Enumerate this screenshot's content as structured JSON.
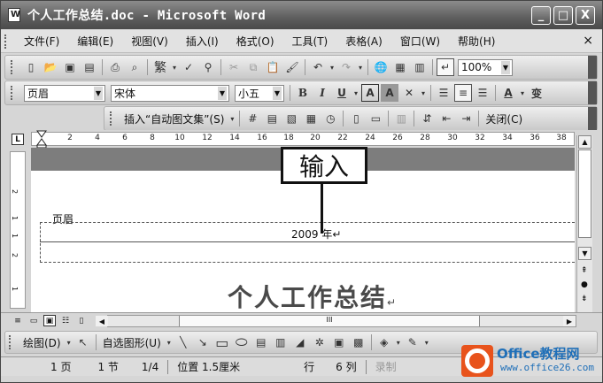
{
  "window": {
    "title": "个人工作总结.doc - Microsoft Word",
    "buttons": {
      "minimize": "_",
      "maximize": "□",
      "close": "X"
    }
  },
  "menubar": {
    "items": [
      "文件(F)",
      "编辑(E)",
      "视图(V)",
      "插入(I)",
      "格式(O)",
      "工具(T)",
      "表格(A)",
      "窗口(W)",
      "帮助(H)"
    ],
    "close": "×"
  },
  "standard_toolbar": {
    "traditional": "繁",
    "zoom": "100%"
  },
  "formatting_toolbar": {
    "style": "页眉",
    "font": "宋体",
    "size": "小五",
    "bold": "B",
    "italic": "I",
    "underline": "U",
    "char_border": "A",
    "char_shading": "A",
    "font_color": "A",
    "phonetic": "变"
  },
  "header_footer_toolbar": {
    "insert_autotext": "插入“自动图文集”(S)",
    "close": "关闭(C)"
  },
  "ruler": {
    "ticks": [
      "2",
      "4",
      "6",
      "8",
      "10",
      "12",
      "14",
      "16",
      "18",
      "20",
      "22",
      "24",
      "26",
      "28",
      "30",
      "32",
      "34",
      "36",
      "38"
    ],
    "tab_selector": "L"
  },
  "vruler": {
    "ticks": [
      "2",
      "1",
      "1",
      "2",
      "1"
    ]
  },
  "document": {
    "header_label": "页眉",
    "header_text": "2009 年",
    "paragraph_mark": "↵",
    "title": "个人工作总结"
  },
  "callout": {
    "text": "输入"
  },
  "hscroll": {
    "thumb_label": "III"
  },
  "drawing_toolbar": {
    "draw": "绘图(D)",
    "autoshapes": "自选图形(U)"
  },
  "statusbar": {
    "page": "1 页",
    "section": "1 节",
    "page_of": "1/4",
    "position": "位置 1.5厘米",
    "line": "行",
    "column": "6 列",
    "record": "录制"
  },
  "watermark": {
    "line1": "Office教程网",
    "line2": "www.office26.com"
  }
}
